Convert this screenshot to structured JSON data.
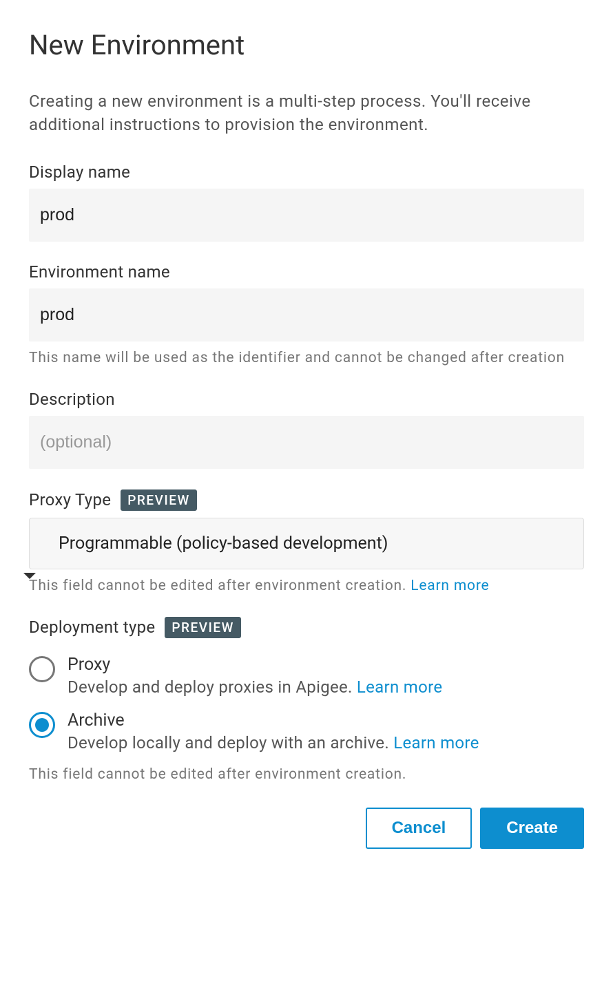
{
  "title": "New Environment",
  "intro": "Creating a new environment is a multi-step process. You'll receive additional instructions to provision the environment.",
  "display_name": {
    "label": "Display name",
    "value": "prod"
  },
  "env_name": {
    "label": "Environment name",
    "value": "prod",
    "helper": "This name will be used as the identifier and cannot be changed after creation"
  },
  "description": {
    "label": "Description",
    "placeholder": "(optional)",
    "value": ""
  },
  "proxy_type": {
    "label": "Proxy Type",
    "badge": "PREVIEW",
    "selected": "Programmable (policy-based development)",
    "helper_text": "This field cannot be edited after environment creation. ",
    "helper_link": "Learn more"
  },
  "deployment_type": {
    "label": "Deployment type",
    "badge": "PREVIEW",
    "options": [
      {
        "title": "Proxy",
        "desc": "Develop and deploy proxies in Apigee. ",
        "link": "Learn more",
        "selected": false
      },
      {
        "title": "Archive",
        "desc": "Develop locally and deploy with an archive. ",
        "link": "Learn more",
        "selected": true
      }
    ],
    "helper": "This field cannot be edited after environment creation."
  },
  "actions": {
    "cancel": "Cancel",
    "create": "Create"
  }
}
